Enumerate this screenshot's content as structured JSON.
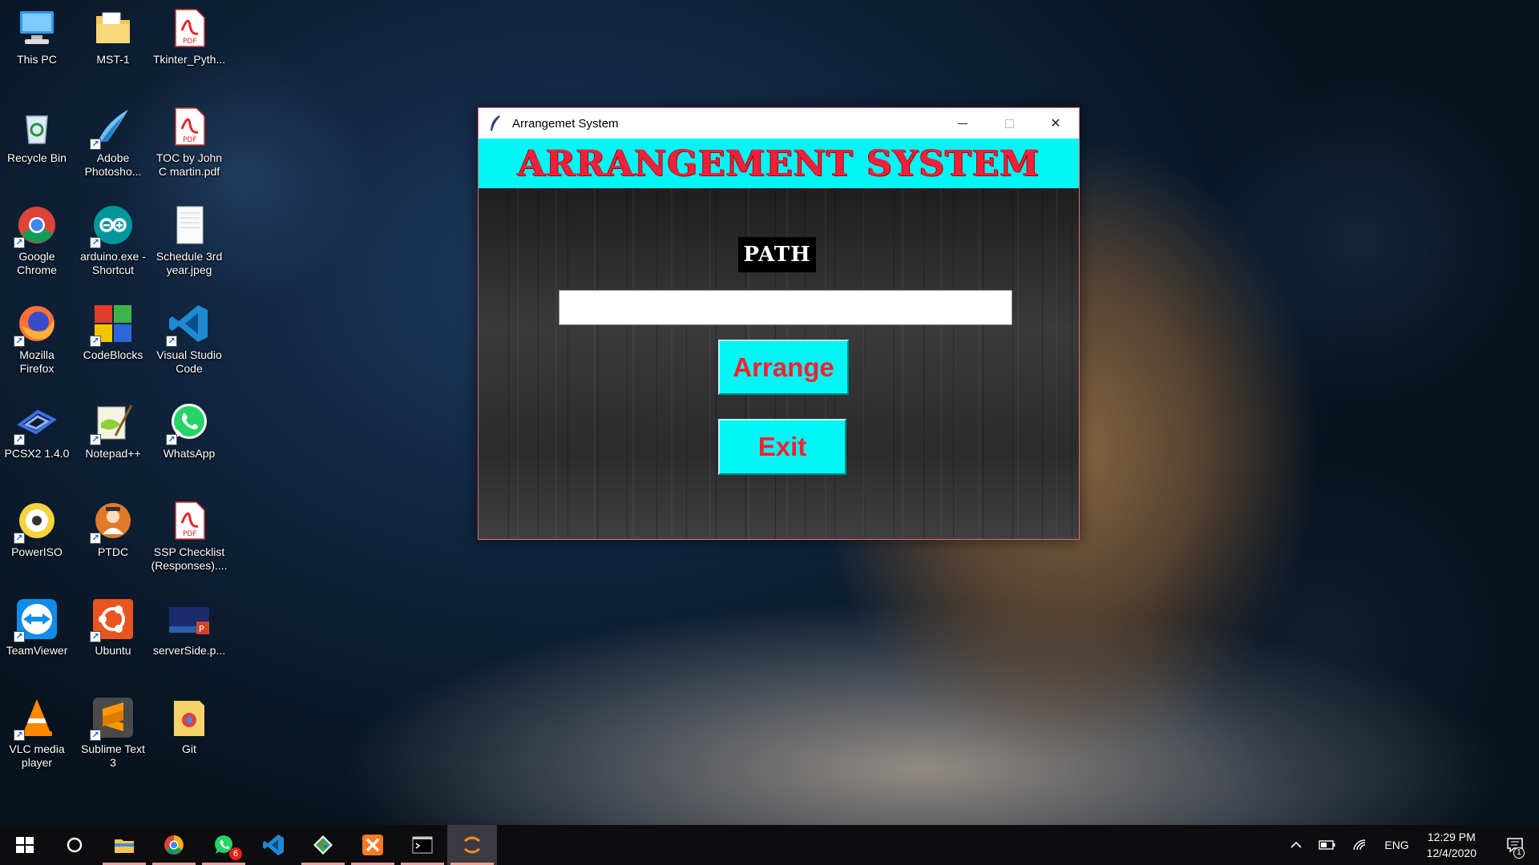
{
  "desktop": {
    "icons": [
      {
        "label": "This PC",
        "icon": "computer-icon"
      },
      {
        "label": "MST-1",
        "icon": "folder-icon"
      },
      {
        "label": "Tkinter_Pyth...",
        "icon": "pdf-icon"
      },
      {
        "label": "Recycle Bin",
        "icon": "recycle-bin-icon"
      },
      {
        "label": "Adobe\nPhotosho...",
        "icon": "photoshop-icon"
      },
      {
        "label": "TOC by John\nC martin.pdf",
        "icon": "pdf-icon"
      },
      {
        "label": "Google\nChrome",
        "icon": "chrome-icon"
      },
      {
        "label": "arduino.exe -\nShortcut",
        "icon": "arduino-icon"
      },
      {
        "label": "Schedule 3rd\nyear.jpeg",
        "icon": "image-file-icon"
      },
      {
        "label": "Mozilla\nFirefox",
        "icon": "firefox-icon"
      },
      {
        "label": "CodeBlocks",
        "icon": "codeblocks-icon"
      },
      {
        "label": "Visual Studio\nCode",
        "icon": "vscode-icon"
      },
      {
        "label": "PCSX2 1.4.0",
        "icon": "pcsx2-icon"
      },
      {
        "label": "Notepad++",
        "icon": "notepadpp-icon"
      },
      {
        "label": "WhatsApp",
        "icon": "whatsapp-icon"
      },
      {
        "label": "PowerISO",
        "icon": "poweriso-icon"
      },
      {
        "label": "PTDC",
        "icon": "ptdc-icon"
      },
      {
        "label": "SSP Checklist\n(Responses)....",
        "icon": "pdf-icon"
      },
      {
        "label": "TeamViewer",
        "icon": "teamviewer-icon"
      },
      {
        "label": "Ubuntu",
        "icon": "ubuntu-icon"
      },
      {
        "label": "serverSide.p...",
        "icon": "powerpoint-file-icon"
      },
      {
        "label": "VLC media\nplayer",
        "icon": "vlc-icon"
      },
      {
        "label": "Sublime Text\n3",
        "icon": "sublime-icon"
      },
      {
        "label": "Git",
        "icon": "git-folder-icon"
      }
    ]
  },
  "window": {
    "title": "Arrangemet System",
    "minimize_glyph": "—",
    "close_glyph": "✕",
    "banner": "ARRANGEMENT SYSTEM",
    "path_label": "PATH",
    "path_value": "",
    "arrange_label": "Arrange",
    "exit_label": "Exit"
  },
  "taskbar": {
    "whatsapp_badge": "6",
    "lang": "ENG",
    "time": "12:29 PM",
    "date": "12/4/2020",
    "notification_count": "1"
  },
  "colors": {
    "banner_bg": "#00f5f5",
    "banner_text": "#f01f3c",
    "button_bg": "#00f5f5",
    "button_text": "#ff1f2f"
  }
}
